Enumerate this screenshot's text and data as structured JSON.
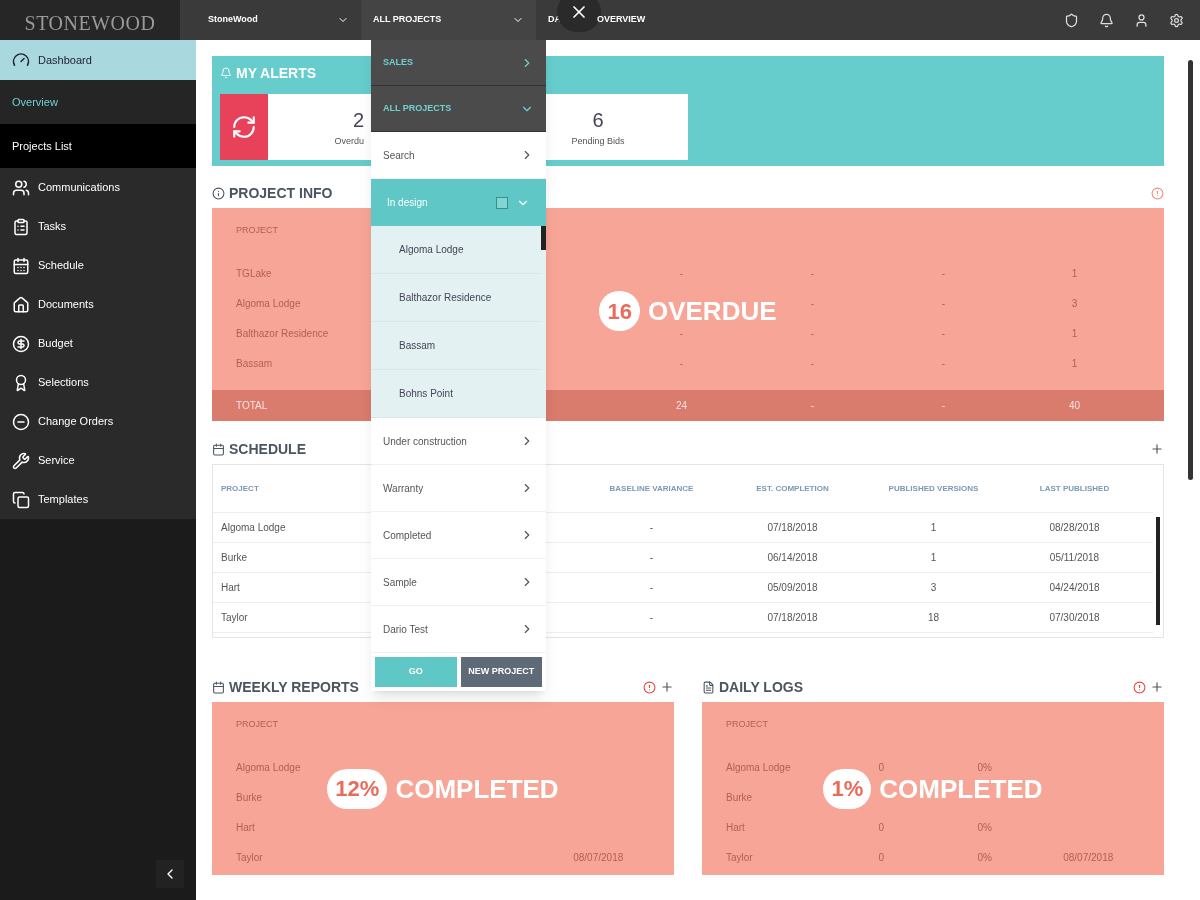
{
  "logo": "STONEWOOD",
  "topbar": {
    "company": "StoneWood",
    "project_select": "ALL PROJECTS",
    "title_start": "DA",
    "title_end": "OVERVIEW"
  },
  "sidebar": {
    "items": [
      {
        "label": "Dashboard",
        "kind": "main",
        "selected": true
      },
      {
        "label": "Overview",
        "kind": "sub",
        "selected": true
      },
      {
        "label": "Projects List",
        "kind": "sub",
        "selected": false
      },
      {
        "label": "Communications",
        "kind": "main",
        "selected": false
      },
      {
        "label": "Tasks",
        "kind": "main",
        "selected": false
      },
      {
        "label": "Schedule",
        "kind": "main",
        "selected": false
      },
      {
        "label": "Documents",
        "kind": "main",
        "selected": false
      },
      {
        "label": "Budget",
        "kind": "main",
        "selected": false
      },
      {
        "label": "Selections",
        "kind": "main",
        "selected": false
      },
      {
        "label": "Change Orders",
        "kind": "main",
        "selected": false
      },
      {
        "label": "Service",
        "kind": "main",
        "selected": false
      },
      {
        "label": "Templates",
        "kind": "main",
        "selected": false
      }
    ]
  },
  "alerts": {
    "title": "MY ALERTS",
    "items": [
      {
        "count": "2",
        "label": "Overdu"
      },
      {
        "count": "6",
        "label": "Pending Bids"
      }
    ]
  },
  "project_info": {
    "title": "PROJECT INFO",
    "overlay_count": "16",
    "overlay_label": "OVERDUE",
    "header": [
      "PROJECT"
    ],
    "rows": [
      {
        "project": "TGLake",
        "column_3": "-",
        "column_4": "-",
        "column_5": "-",
        "column_6": "1"
      },
      {
        "project": "Algoma Lodge",
        "column_4": "-",
        "column_5": "-",
        "column_6": "3"
      },
      {
        "project": "Balthazor Residence",
        "column_3": "-",
        "column_4": "-",
        "column_5": "-",
        "column_6": "1"
      },
      {
        "project": "Bassam",
        "column_3": "-",
        "column_4": "-",
        "column_5": "-",
        "column_6": "1"
      }
    ],
    "total": {
      "project": "TOTAL",
      "column_3": "24",
      "column_4": "-",
      "column_5": "-",
      "column_6": "40"
    }
  },
  "schedule": {
    "title": "SCHEDULE",
    "columns": [
      "PROJECT",
      "BASELINE VARIANCE",
      "EST. COMPLETION",
      "PUBLISHED VERSIONS",
      "LAST PUBLISHED"
    ],
    "rows": [
      [
        "Algoma Lodge",
        "-",
        "07/18/2018",
        "1",
        "08/28/2018"
      ],
      [
        "Burke",
        "-",
        "06/14/2018",
        "1",
        "05/11/2018"
      ],
      [
        "Hart",
        "-",
        "05/09/2018",
        "3",
        "04/24/2018"
      ],
      [
        "Taylor",
        "-",
        "07/18/2018",
        "18",
        "07/30/2018"
      ]
    ]
  },
  "weekly_reports": {
    "title": "WEEKLY REPORTS",
    "overlay_count": "12%",
    "overlay_label": "COMPLETED",
    "header": [
      "PROJECT"
    ],
    "rows": [
      {
        "project": "Algoma Lodge"
      },
      {
        "project": "Burke"
      },
      {
        "project": "Hart"
      },
      {
        "project": "Taylor",
        "column_4": "08/07/2018"
      }
    ]
  },
  "daily_logs": {
    "title": "DAILY LOGS",
    "overlay_count": "1%",
    "overlay_label": "COMPLETED",
    "header": [
      "PROJECT"
    ],
    "rows": [
      {
        "project": "Algoma Lodge",
        "column_2": "0",
        "column_3": "0%"
      },
      {
        "project": "Burke"
      },
      {
        "project": "Hart",
        "column_2": "0",
        "column_3": "0%"
      },
      {
        "project": "Taylor",
        "column_2": "0",
        "column_3": "0%",
        "column_4": "08/07/2018"
      }
    ]
  },
  "dropdown": {
    "items": [
      {
        "label": "SALES",
        "kind": "section",
        "expanded": false
      },
      {
        "label": "ALL PROJECTS",
        "kind": "section",
        "expanded": true
      },
      {
        "label": "Search",
        "kind": "item",
        "expanded": false
      },
      {
        "label": "In design",
        "kind": "group",
        "expanded": true,
        "checked": false,
        "children": [
          "Algoma Lodge",
          "Balthazor Residence",
          "Bassam",
          "Bohns Point"
        ]
      },
      {
        "label": "Under construction",
        "kind": "item",
        "expanded": false
      },
      {
        "label": "Warranty",
        "kind": "item",
        "expanded": false
      },
      {
        "label": "Completed",
        "kind": "item",
        "expanded": false
      },
      {
        "label": "Sample",
        "kind": "item",
        "expanded": false
      },
      {
        "label": "Dario Test",
        "kind": "item",
        "expanded": false
      }
    ],
    "buttons": [
      {
        "label": "GO",
        "kind": "primary"
      },
      {
        "label": "NEW PROJECT",
        "kind": "secondary"
      }
    ]
  }
}
